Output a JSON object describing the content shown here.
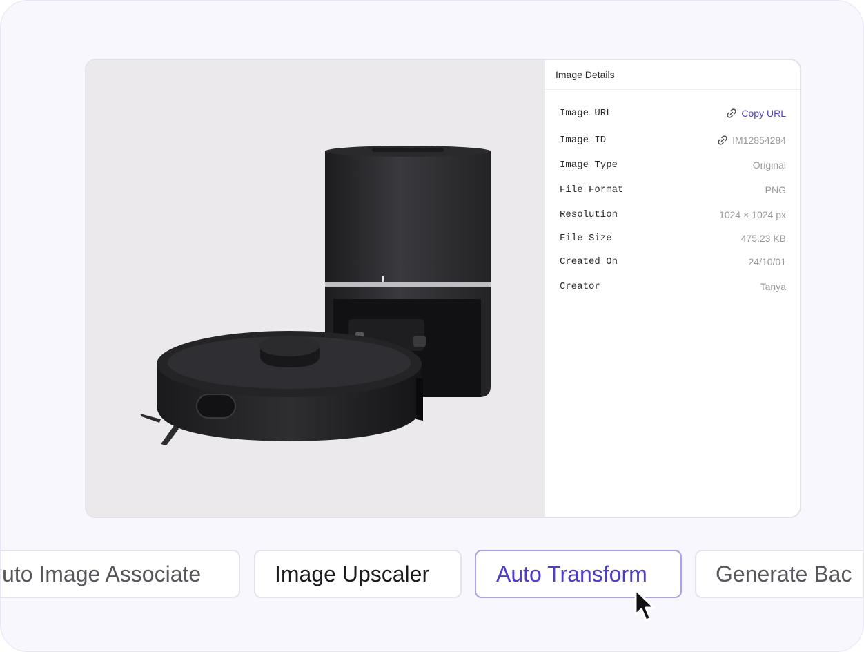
{
  "details": {
    "header": "Image Details",
    "rows": [
      {
        "label": "Image URL",
        "value": "Copy URL",
        "icon": "link-icon"
      },
      {
        "label": "Image ID",
        "value": "IM12854284",
        "icon": "link-icon"
      },
      {
        "label": "Image Type",
        "value": "Original"
      },
      {
        "label": "File Format",
        "value": "PNG"
      },
      {
        "label": "Resolution",
        "value": "1024 × 1024 px"
      },
      {
        "label": "File Size",
        "value": "475.23 KB"
      },
      {
        "label": "Created On",
        "value": "24/10/01"
      },
      {
        "label": "Creator",
        "value": "Tanya"
      }
    ]
  },
  "tools": [
    {
      "label": "uto Image Associate"
    },
    {
      "label": "Image Upscaler"
    },
    {
      "label": "Auto Transform",
      "active": true
    },
    {
      "label": "Generate Bac"
    }
  ],
  "colors": {
    "accent": "#4b3bdc",
    "accent_border": "#a6a1f2",
    "background": "#f8f7fd"
  }
}
